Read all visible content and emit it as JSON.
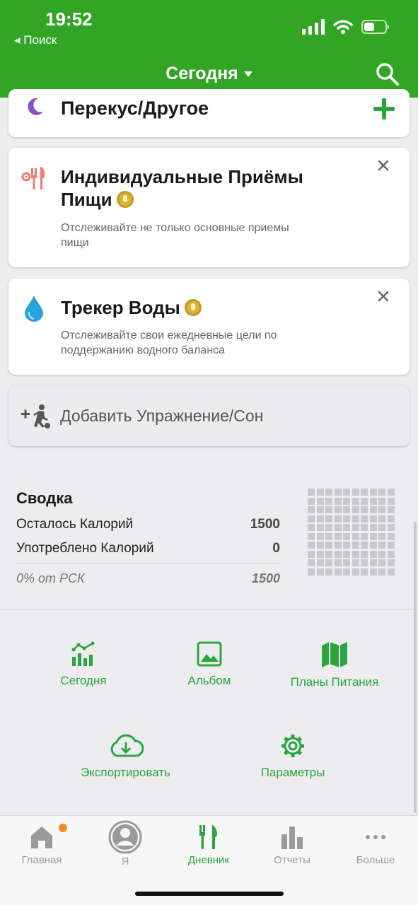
{
  "status": {
    "time": "19:52",
    "back_label": "◂ Поиск"
  },
  "header": {
    "title": "Сегодня"
  },
  "snack_row": {
    "label": "Перекус/Другое"
  },
  "cards": [
    {
      "title": "Индивидуальные Приёмы Пищи",
      "description": "Отслеживайте не только основные приемы пищи"
    },
    {
      "title": "Трекер Воды",
      "description": "Отслеживайте свои ежедневные цели по поддержанию водного баланса"
    }
  ],
  "exercise": {
    "label": "Добавить Упражнение/Сон"
  },
  "summary": {
    "title": "Сводка",
    "remaining_label": "Осталось Калорий",
    "remaining_value": "1500",
    "consumed_label": "Употреблено Калорий",
    "consumed_value": "0",
    "percent_label": "0% от РСК",
    "percent_value": "1500"
  },
  "actions": {
    "today": "Сегодня",
    "album": "Альбом",
    "meal_plans": "Планы Питания",
    "export": "Экспортировать",
    "settings": "Параметры"
  },
  "tabs": {
    "home": "Главная",
    "me": "Я",
    "diary": "Дневник",
    "reports": "Отчеты",
    "more": "Больше"
  },
  "colors": {
    "brand_green": "#33a524",
    "accent_green": "#2aa63d",
    "notification": "#f28a23"
  }
}
